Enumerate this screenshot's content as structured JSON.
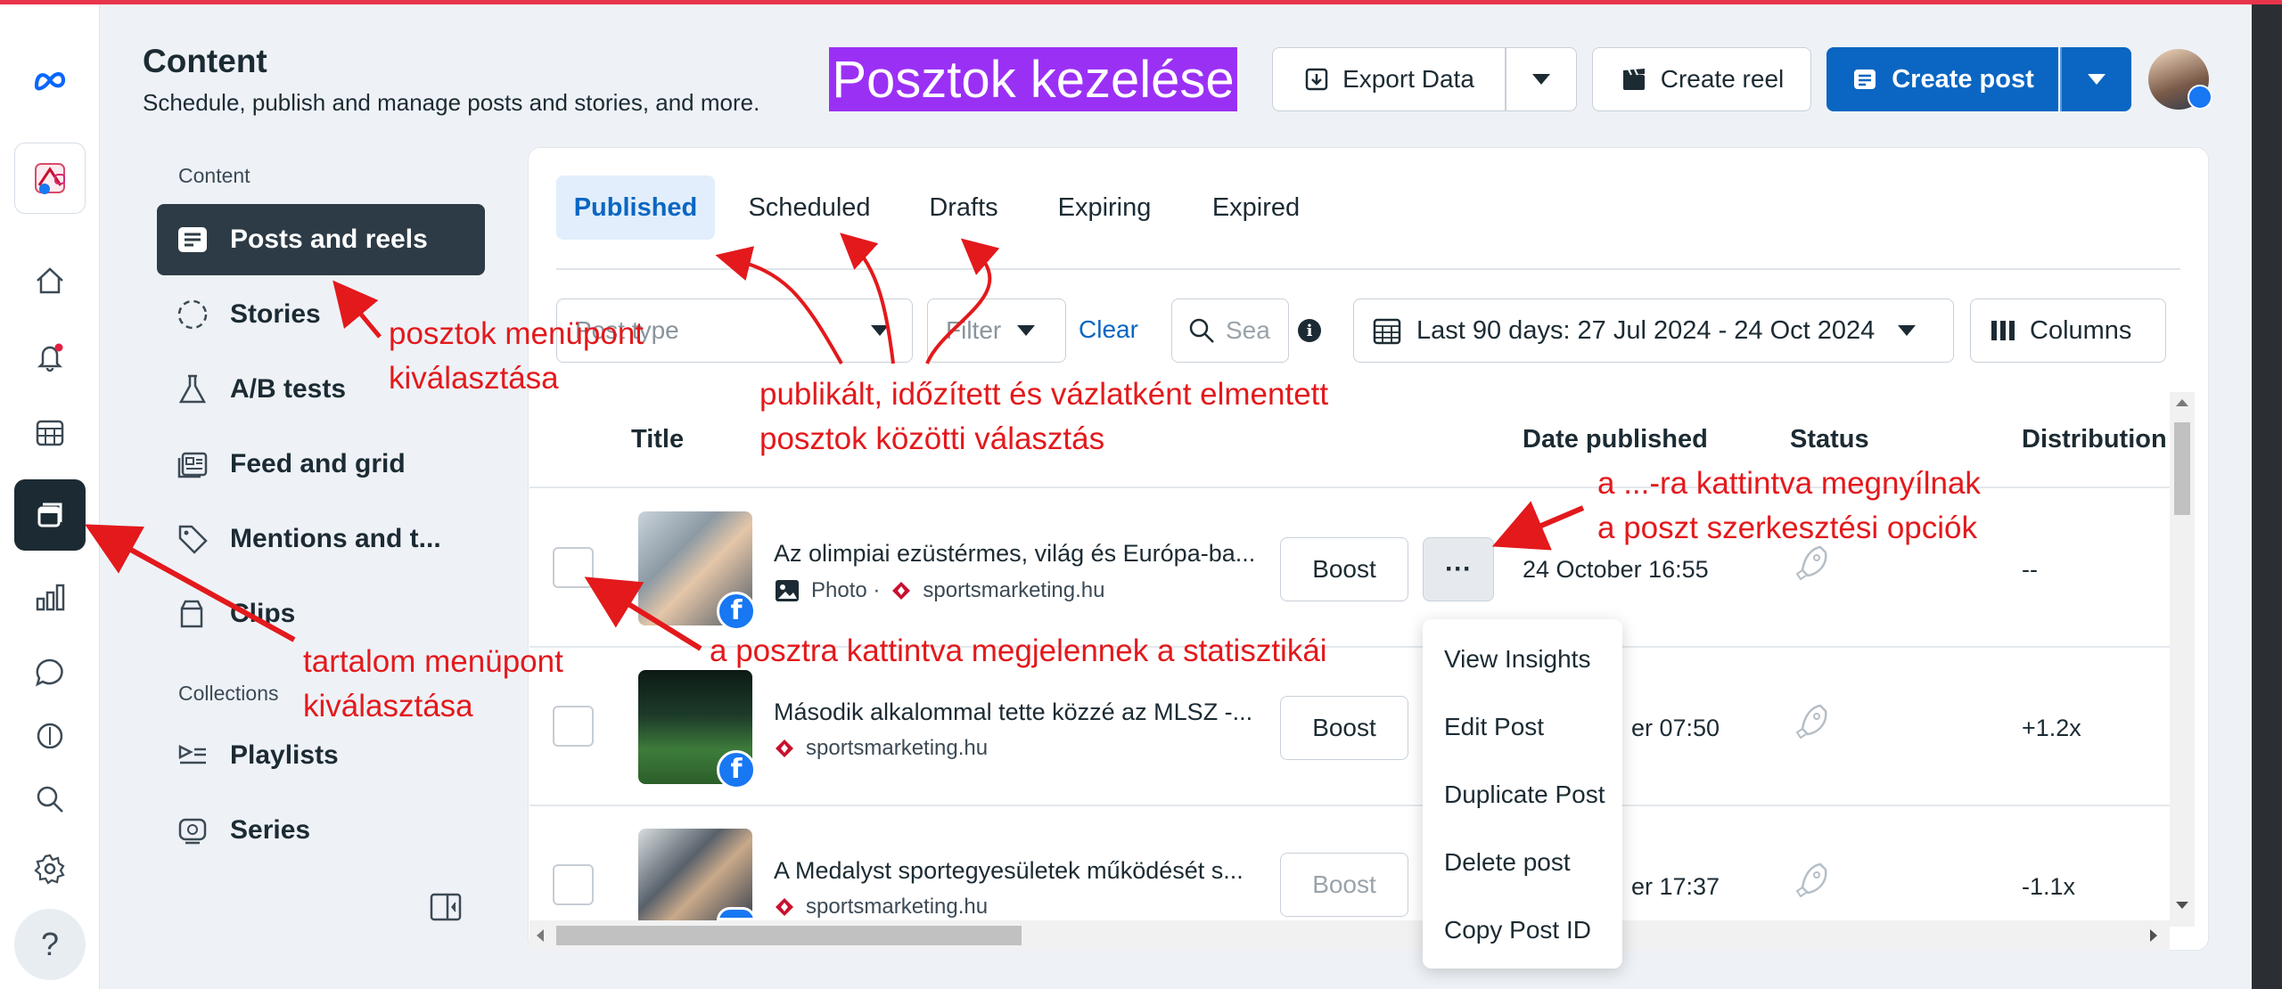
{
  "header": {
    "title": "Content",
    "subtitle": "Schedule, publish and manage posts and stories, and more.",
    "banner": "Posztok kezelése"
  },
  "toolbar": {
    "export_label": "Export Data",
    "create_reel_label": "Create reel",
    "create_post_label": "Create post"
  },
  "left_nav": {
    "section_content": "Content",
    "section_collections": "Collections",
    "items": [
      {
        "label": "Posts and reels"
      },
      {
        "label": "Stories"
      },
      {
        "label": "A/B tests"
      },
      {
        "label": "Feed and grid"
      },
      {
        "label": "Mentions and t..."
      },
      {
        "label": "Clips"
      }
    ],
    "collections": [
      {
        "label": "Playlists"
      },
      {
        "label": "Series"
      }
    ]
  },
  "tabs": [
    {
      "label": "Published",
      "active": true
    },
    {
      "label": "Scheduled"
    },
    {
      "label": "Drafts"
    },
    {
      "label": "Expiring"
    },
    {
      "label": "Expired"
    }
  ],
  "filters": {
    "post_type_placeholder": "Post type",
    "filter_label": "Filter",
    "clear_label": "Clear",
    "search_placeholder": "Sea",
    "date_range": "Last 90 days: 27 Jul 2024 - 24 Oct 2024",
    "columns_label": "Columns"
  },
  "table": {
    "headers": [
      "Title",
      "Date published",
      "Status",
      "Distribution"
    ],
    "rows": [
      {
        "title": "Az olimpiai ezüstérmes, világ és Európa-ba...",
        "type": "Photo ·",
        "source": "sportsmarketing.hu",
        "date": "24 October 16:55",
        "distribution": "--",
        "boost": "Boost"
      },
      {
        "title": "Második alkalommal tette közzé az MLSZ -...",
        "source": "sportsmarketing.hu",
        "date": "er 07:50",
        "distribution": "+1.2x",
        "boost": "Boost"
      },
      {
        "title": "A Medalyst sportegyesületek működését s...",
        "source": "sportsmarketing.hu",
        "date": "er 17:37",
        "distribution": "-1.1x",
        "boost": "Boost"
      }
    ]
  },
  "more_menu": {
    "button_label": "···",
    "items": [
      "View Insights",
      "Edit Post",
      "Duplicate Post",
      "Delete post",
      "Copy Post ID"
    ]
  },
  "annotations": {
    "posts_menu": [
      "posztok menüpont",
      "kiválasztása"
    ],
    "content_menu": [
      "tartalom menüpont",
      "kiválasztása"
    ],
    "tabs_hint": [
      "publikált, időzített és vázlatként elmentett",
      "posztok közötti választás"
    ],
    "more_hint": [
      "a ...-ra kattintva megnyílnak",
      "a poszt szerkesztési opciók"
    ],
    "post_click_hint": "a posztra kattintva megjelennek a statisztikái"
  },
  "colors": {
    "accent": "#0a66c2",
    "annotation": "#e3191c",
    "banner": "#9b30f5",
    "nav_active": "#2d3b46"
  },
  "help_label": "?"
}
